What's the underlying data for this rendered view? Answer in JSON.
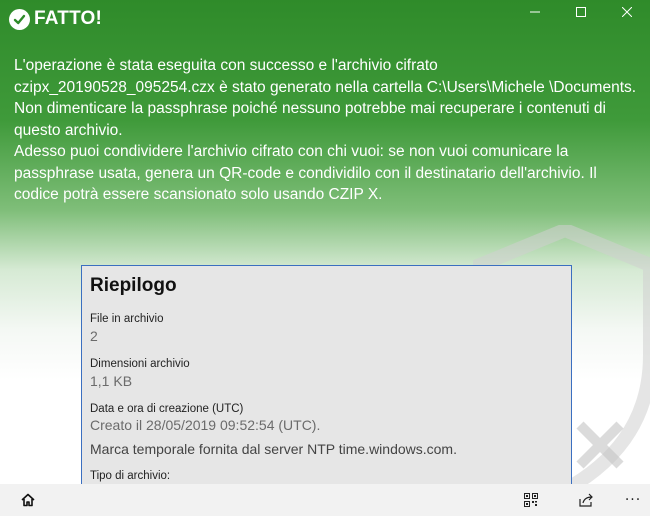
{
  "window": {
    "title": "FATTO!",
    "minimize_glyph": "—",
    "maximize_glyph": "☐",
    "close_glyph": "✕"
  },
  "message": {
    "para1": "L'operazione è stata eseguita con successo e l'archivio cifrato czipx_20190528_095254.czx è stato generato nella cartella C:\\Users\\Michele \\Documents.",
    "para2": "Non dimenticare la passphrase poiché nessuno potrebbe mai recuperare i contenuti di questo archivio.",
    "para3": "Adesso puoi condividere l'archivio cifrato con chi vuoi: se non vuoi comunicare la passphrase usata, genera un QR-code e condividilo con il destinatario dell'archivio. Il codice potrà essere scansionato solo usando CZIP X."
  },
  "summary": {
    "title": "Riepilogo",
    "files_label": "File in archivio",
    "files_value": "2",
    "size_label": "Dimensioni archivio",
    "size_value": "1,1 KB",
    "date_label": "Data e ora di creazione (UTC)",
    "date_value": "Creato il 28/05/2019 09:52:54 (UTC).",
    "timestamp_note": "Marca temporale fornita dal server NTP time.windows.com.",
    "type_label": "Tipo di archivio:"
  },
  "bottombar": {
    "more_glyph": "···"
  },
  "colors": {
    "header_green": "#2f8b2a",
    "summary_bg": "#e6e6e6",
    "summary_border": "#3b6fc0",
    "bottombar_bg": "#f2f2f2"
  }
}
